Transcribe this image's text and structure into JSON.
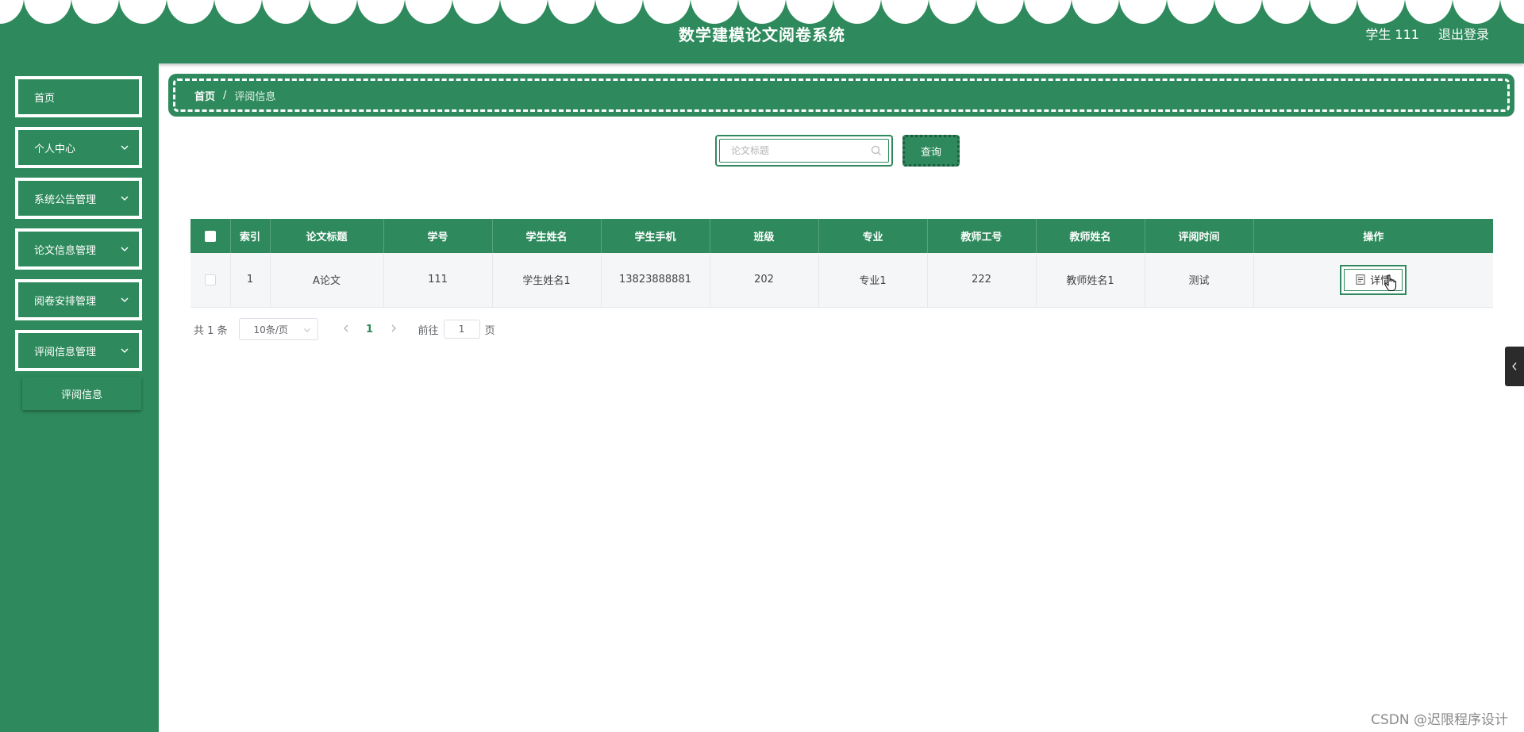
{
  "header": {
    "title": "数学建模论文阅卷系统",
    "user_label": "学生 111",
    "logout_label": "退出登录"
  },
  "sidebar": {
    "items": [
      {
        "label": "首页",
        "has_children": false
      },
      {
        "label": "个人中心",
        "has_children": true
      },
      {
        "label": "系统公告管理",
        "has_children": true
      },
      {
        "label": "论文信息管理",
        "has_children": true
      },
      {
        "label": "阅卷安排管理",
        "has_children": true
      },
      {
        "label": "评阅信息管理",
        "has_children": true
      }
    ],
    "sub_item": "评阅信息"
  },
  "breadcrumb": {
    "home": "首页",
    "separator": "/",
    "current": "评阅信息"
  },
  "search": {
    "placeholder": "论文标题",
    "value": "",
    "button_label": "查询"
  },
  "table": {
    "headers": [
      "索引",
      "论文标题",
      "学号",
      "学生姓名",
      "学生手机",
      "班级",
      "专业",
      "教师工号",
      "教师姓名",
      "评阅时间",
      "操作"
    ],
    "rows": [
      {
        "index": "1",
        "title": "A论文",
        "student_id": "111",
        "student_name": "学生姓名1",
        "phone": "13823888881",
        "class": "202",
        "major": "专业1",
        "teacher_id": "222",
        "teacher_name": "教师姓名1",
        "review_time": "测试",
        "action_label": "详情"
      }
    ]
  },
  "pagination": {
    "total": "共 1 条",
    "page_size": "10条/页",
    "current_page": "1",
    "goto_label": "前往",
    "goto_value": "1",
    "page_suffix": "页"
  },
  "watermark": "CSDN @迟限程序设计",
  "colors": {
    "primary": "#2e8a5c",
    "header_bg": "#2e8a5c",
    "table_row_bg": "#f5f6f7"
  }
}
